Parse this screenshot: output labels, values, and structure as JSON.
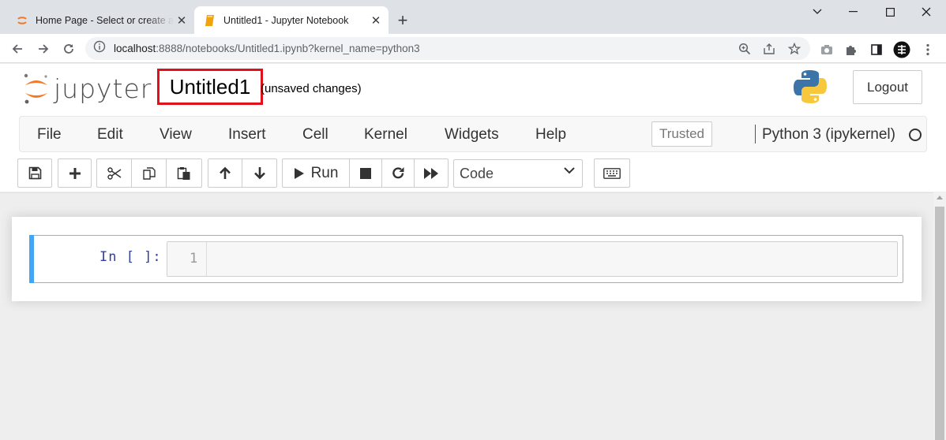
{
  "browser": {
    "tabs": [
      {
        "title": "Home Page - Select or create a notebook",
        "icon": "jupyter-favicon"
      },
      {
        "title": "Untitled1 - Jupyter Notebook",
        "icon": "notebook-favicon"
      }
    ],
    "url_host": "localhost",
    "url_rest": ":8888/notebooks/Untitled1.ipynb?kernel_name=python3"
  },
  "header": {
    "logo_text": "jupyter",
    "notebook_name": "Untitled1",
    "autosave_status": "(unsaved changes)",
    "logout_label": "Logout",
    "highlight_color": "#e0111b"
  },
  "menubar": {
    "items": [
      "File",
      "Edit",
      "View",
      "Insert",
      "Cell",
      "Kernel",
      "Widgets",
      "Help"
    ],
    "trusted_label": "Trusted",
    "kernel_name": "Python 3 (ipykernel)"
  },
  "toolbar": {
    "run_label": "Run",
    "cell_type": "Code"
  },
  "cell": {
    "prompt": "In [ ]:",
    "line_number": "1",
    "accent_color": "#42a5f5"
  }
}
